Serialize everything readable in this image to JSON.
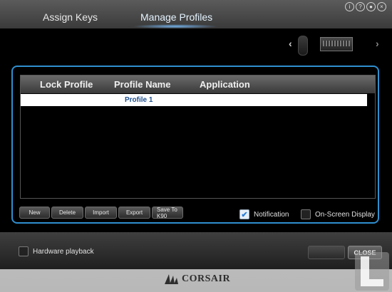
{
  "tabs": [
    {
      "label": "Assign Keys"
    },
    {
      "label": "Manage Profiles",
      "active": true
    }
  ],
  "top_icons": [
    "info-icon",
    "help-icon",
    "globe-icon",
    "close-icon"
  ],
  "table": {
    "headers": [
      "Lock Profile",
      "Profile Name",
      "Application"
    ],
    "rows": [
      {
        "profile_name": "Profile 1"
      }
    ]
  },
  "buttons": {
    "new": "New",
    "delete": "Delete",
    "import": "Import",
    "export": "Export",
    "save_to": "Save To K90"
  },
  "options": {
    "notification": {
      "label": "Notification",
      "checked": true
    },
    "on_screen_display": {
      "label": "On-Screen Display",
      "checked": false
    }
  },
  "bottom": {
    "hardware_playback": {
      "label": "Hardware playback",
      "checked": false
    },
    "close_label": "CLOSE"
  },
  "brand": "CORSAIR",
  "colors": {
    "accent": "#2f8fd0",
    "tab_active": "#e6f4ff",
    "profile_text": "#1d4f8f"
  }
}
